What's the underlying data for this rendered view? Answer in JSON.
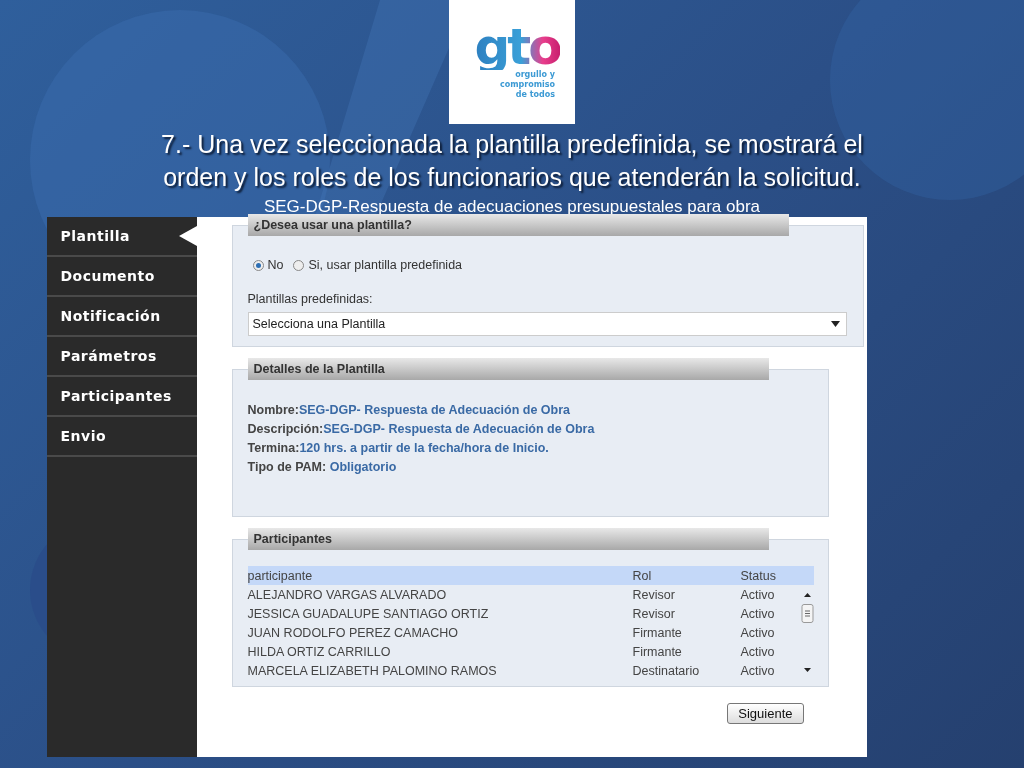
{
  "logo": {
    "mark": "gto",
    "tagline": [
      "orgullo y",
      "compromiso",
      "de todos"
    ]
  },
  "title": [
    "7.- Una vez seleccionada la plantilla predefinida, se mostrará el",
    "orden y los roles de los funcionarios que atenderán la solicitud."
  ],
  "subtitle": "SEG-DGP-Respuesta de adecuaciones presupuestales para obra",
  "sidebar": {
    "items": [
      {
        "label": "Plantilla",
        "selected": true
      },
      {
        "label": "Documento",
        "selected": false
      },
      {
        "label": "Notificación",
        "selected": false
      },
      {
        "label": "Parámetros",
        "selected": false
      },
      {
        "label": "Participantes",
        "selected": false
      },
      {
        "label": "Envio",
        "selected": false
      }
    ]
  },
  "template_section": {
    "title": "¿Desea usar una plantilla?",
    "options": [
      {
        "label": "No",
        "selected": true
      },
      {
        "label": "Si, usar plantilla predefinida",
        "selected": false
      }
    ],
    "select_label": "Plantillas predefinidas:",
    "select_value": "Selecciona una Plantilla"
  },
  "details": {
    "title": "Detalles de la Plantilla",
    "lines": [
      "**Nombre:**SEG-DGP- Respuesta de Adecuación de Obra",
      "**Descripción:**SEG-DGP- Respuesta de Adecuación de Obra",
      "**Termina:**120 hrs. a partir de la fecha/hora de Inicio.",
      "**Tipo de PAM:** Obligatorio"
    ]
  },
  "participants": {
    "title": "Participantes",
    "columns": [
      "participante",
      "Rol",
      "Status"
    ],
    "rows": [
      [
        "ALEJANDRO VARGAS ALVARADO",
        "Revisor",
        "Activo"
      ],
      [
        "JESSICA GUADALUPE SANTIAGO ORTIZ",
        "Revisor",
        "Activo"
      ],
      [
        "JUAN RODOLFO PEREZ CAMACHO",
        "Firmante",
        "Activo"
      ],
      [
        "HILDA ORTIZ CARRILLO",
        "Firmante",
        "Activo"
      ],
      [
        "MARCELA ELIZABETH PALOMINO RAMOS",
        "Destinatario",
        "Activo"
      ]
    ]
  },
  "buttons": [
    "Siguiente"
  ]
}
